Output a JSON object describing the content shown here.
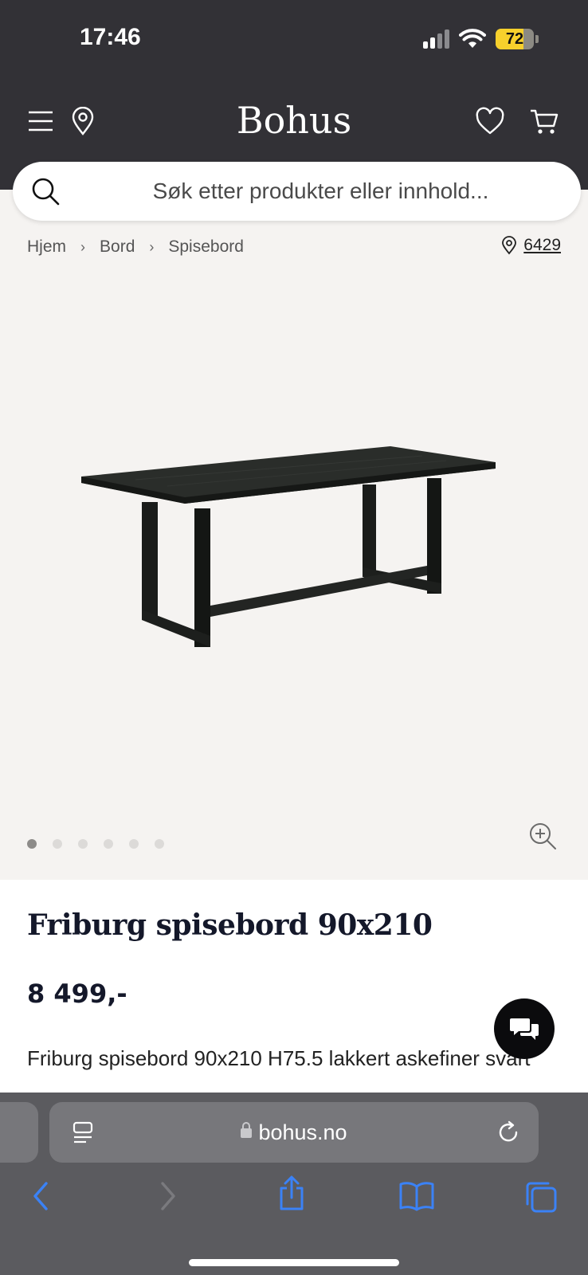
{
  "status_bar": {
    "time": "17:46",
    "battery": "72",
    "battery_level": 0.72
  },
  "header": {
    "brand": "Bohus",
    "menu_icon": "hamburger-menu-icon",
    "location_icon": "map-pin-icon",
    "wishlist_icon": "heart-icon",
    "cart_icon": "shopping-cart-icon"
  },
  "search": {
    "placeholder": "Søk etter produkter eller innhold..."
  },
  "breadcrumb": {
    "items": [
      "Hjem",
      "Bord",
      "Spisebord"
    ],
    "postal_code": "6429"
  },
  "gallery": {
    "image_count": 6,
    "active_index": 0
  },
  "product": {
    "title": "Friburg spisebord 90x210",
    "price": "8 499,-",
    "description": "Friburg spisebord 90x210 H75.5 lakkert askefiner svart"
  },
  "browser": {
    "url": "bohus.no"
  },
  "colors": {
    "header_bg": "#323136",
    "page_bg": "#f5f3f1",
    "text_dark": "#14182a",
    "link_blue": "#3b82f6"
  }
}
